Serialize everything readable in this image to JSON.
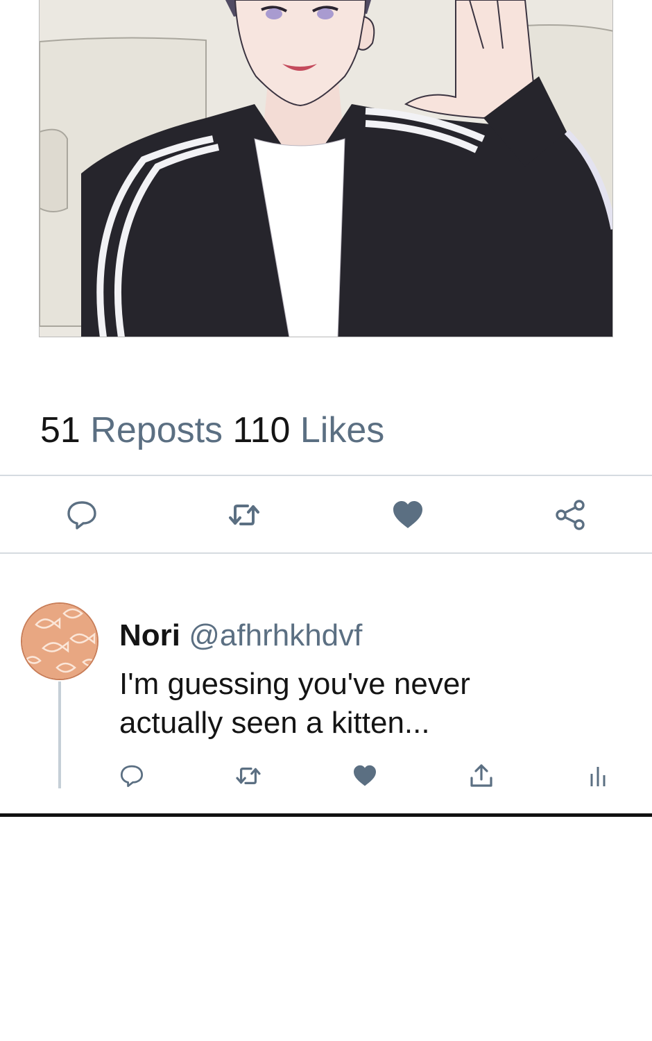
{
  "post": {
    "image_alt": "Illustration of a smiling dark-haired man in a black track jacket waving",
    "stats": {
      "reposts_count": "51",
      "reposts_label": "Reposts",
      "likes_count": "110",
      "likes_label": "Likes"
    },
    "actions": [
      {
        "icon": "comment-icon"
      },
      {
        "icon": "repost-icon"
      },
      {
        "icon": "heart-icon"
      },
      {
        "icon": "share-icon"
      }
    ]
  },
  "reply": {
    "name": "Nori",
    "handle": "@afhrhkhdvf",
    "text_line1": "I'm guessing you've never",
    "text_line2": "actually seen a kitten...",
    "actions": [
      {
        "icon": "comment-icon"
      },
      {
        "icon": "repost-icon"
      },
      {
        "icon": "heart-icon"
      },
      {
        "icon": "upload-icon"
      },
      {
        "icon": "analytics-icon"
      }
    ]
  },
  "colors": {
    "accent": "#5b6f82",
    "text": "#141414",
    "divider": "#d5dbe0",
    "avatar_bg": "#e8a782"
  }
}
